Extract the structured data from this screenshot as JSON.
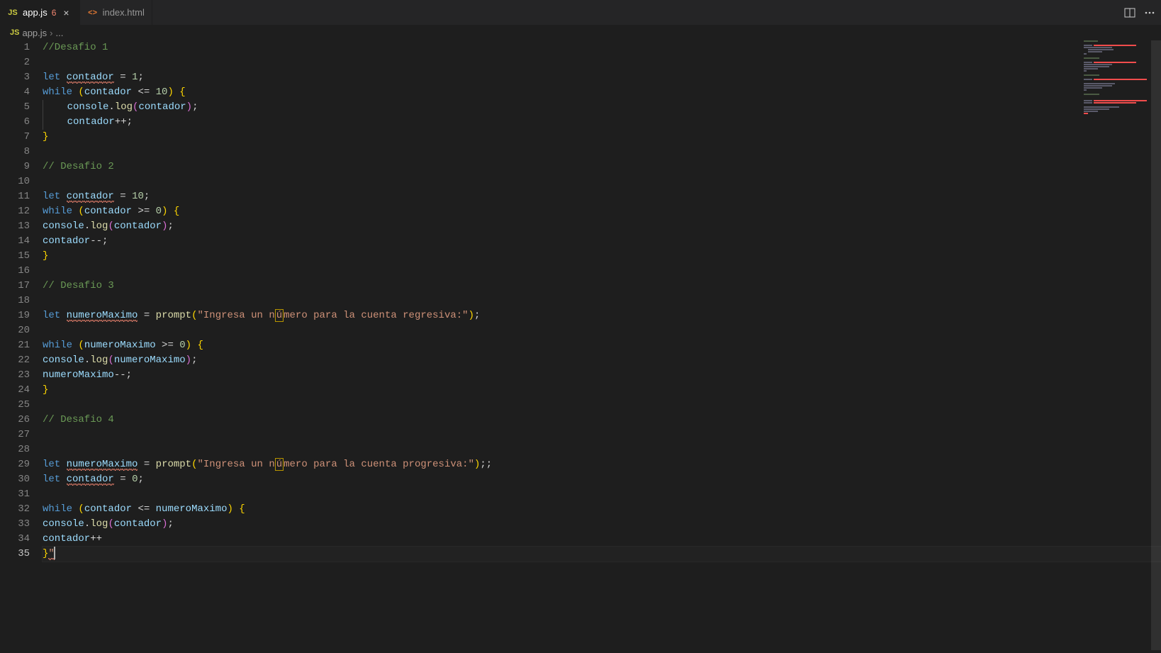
{
  "tabs": [
    {
      "name": "app.js",
      "iconText": "JS",
      "iconClass": "js",
      "active": true,
      "badge": "6"
    },
    {
      "name": "index.html",
      "iconText": "<>",
      "iconClass": "html",
      "active": false,
      "badge": null
    }
  ],
  "breadcrumb": {
    "iconText": "JS",
    "file": "app.js",
    "sep": "›",
    "more": "..."
  },
  "lineCount": 35,
  "currentLine": 35,
  "code": {
    "l1": "//Desafio 1",
    "l3_let": "let",
    "l3_var": "contador",
    "l3_rest": " = ",
    "l3_num": "1",
    "l3_end": ";",
    "l4_while": "while",
    "l4_sp": " ",
    "l4_p1": "(",
    "l4_var": "contador",
    "l4_op": " <= ",
    "l4_num": "10",
    "l4_p2": ")",
    "l4_sp2": " ",
    "l4_b": "{",
    "l5_pad": "    ",
    "l5_obj": "console",
    "l5_dot": ".",
    "l5_fn": "log",
    "l5_p1": "(",
    "l5_var": "contador",
    "l5_p2": ")",
    "l5_end": ";",
    "l6_pad": "    ",
    "l6_var": "contador",
    "l6_op": "++;",
    "l7_b": "}",
    "l9": "// Desafio 2",
    "l11_let": "let",
    "l11_var": "contador",
    "l11_rest": " = ",
    "l11_num": "10",
    "l11_end": ";",
    "l12_while": "while",
    "l12_sp": " ",
    "l12_p1": "(",
    "l12_var": "contador",
    "l12_op": " >= ",
    "l12_num": "0",
    "l12_p2": ")",
    "l12_sp2": " ",
    "l12_b": "{",
    "l13_obj": "console",
    "l13_dot": ".",
    "l13_fn": "log",
    "l13_p1": "(",
    "l13_var": "contador",
    "l13_p2": ")",
    "l13_end": ";",
    "l14_var": "contador",
    "l14_op": "--;",
    "l15_b": "}",
    "l17": "// Desafio 3",
    "l19_let": "let",
    "l19_var": "numeroMaximo",
    "l19_eq": " = ",
    "l19_fn": "prompt",
    "l19_p1": "(",
    "l19_str1": "\"Ingresa un n",
    "l19_u": "ú",
    "l19_str2": "mero para la cuenta regresiva:\"",
    "l19_p2": ")",
    "l19_end": ";",
    "l21_while": "while",
    "l21_sp": " ",
    "l21_p1": "(",
    "l21_var": "numeroMaximo",
    "l21_op": " >= ",
    "l21_num": "0",
    "l21_p2": ")",
    "l21_sp2": " ",
    "l21_b": "{",
    "l22_obj": "console",
    "l22_dot": ".",
    "l22_fn": "log",
    "l22_p1": "(",
    "l22_var": "numeroMaximo",
    "l22_p2": ")",
    "l22_end": ";",
    "l23_var": "numeroMaximo",
    "l23_op": "--;",
    "l24_b": "}",
    "l26": "// Desafio 4",
    "l29_let": "let",
    "l29_var": "numeroMaximo",
    "l29_eq": " = ",
    "l29_fn": "prompt",
    "l29_p1": "(",
    "l29_str1": "\"Ingresa un n",
    "l29_u": "ú",
    "l29_str2": "mero para la cuenta progresiva:\"",
    "l29_p2": ")",
    "l29_end": ";;",
    "l30_let": "let",
    "l30_var": "contador",
    "l30_eq": " = ",
    "l30_num": "0",
    "l30_end": ";",
    "l32_while": "while",
    "l32_sp": " ",
    "l32_p1": "(",
    "l32_var1": "contador",
    "l32_op": " <= ",
    "l32_var2": "numeroMaximo",
    "l32_p2": ")",
    "l32_sp2": " ",
    "l32_b": "{",
    "l33_obj": "console",
    "l33_dot": ".",
    "l33_fn": "log",
    "l33_p1": "(",
    "l33_var": "contador",
    "l33_p2": ")",
    "l33_end": ";",
    "l34_var": "contador",
    "l34_op": "++",
    "l35_b": "}",
    "l35_q": "\""
  }
}
